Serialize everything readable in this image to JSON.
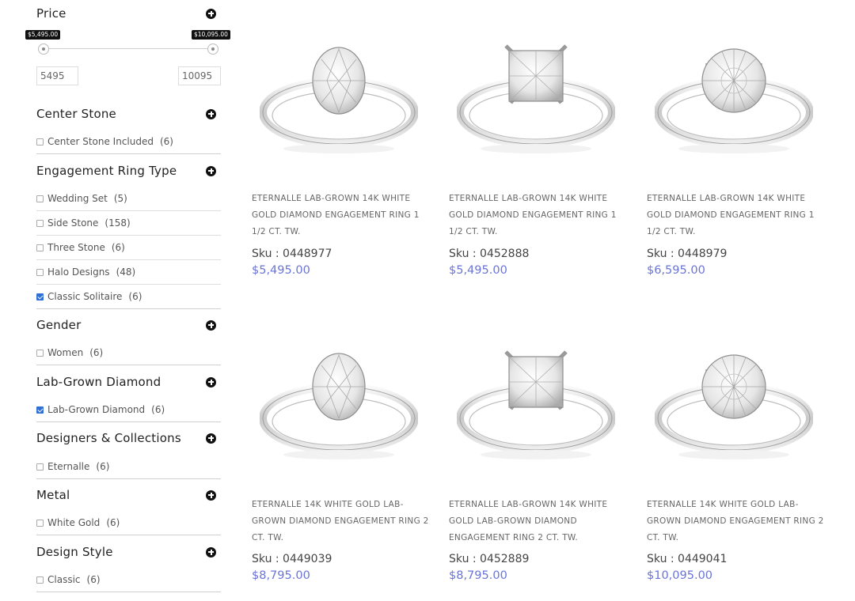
{
  "filters": {
    "price": {
      "title": "Price",
      "min_tip": "$5,495.00",
      "max_tip": "$10,095.00",
      "min_value": "5495",
      "max_value": "10095"
    },
    "center_stone": {
      "title": "Center Stone",
      "options": [
        {
          "label": "Center Stone Included",
          "count": "(6)",
          "checked": false
        }
      ]
    },
    "ring_type": {
      "title": "Engagement Ring Type",
      "options": [
        {
          "label": "Wedding Set",
          "count": "(5)",
          "checked": false
        },
        {
          "label": "Side Stone",
          "count": "(158)",
          "checked": false
        },
        {
          "label": "Three Stone",
          "count": "(6)",
          "checked": false
        },
        {
          "label": "Halo Designs",
          "count": "(48)",
          "checked": false
        },
        {
          "label": "Classic Solitaire",
          "count": "(6)",
          "checked": true
        }
      ]
    },
    "gender": {
      "title": "Gender",
      "options": [
        {
          "label": "Women",
          "count": "(6)",
          "checked": false
        }
      ]
    },
    "lab_grown": {
      "title": "Lab-Grown Diamond",
      "options": [
        {
          "label": "Lab-Grown Diamond",
          "count": "(6)",
          "checked": true
        }
      ]
    },
    "designers": {
      "title": "Designers & Collections",
      "options": [
        {
          "label": "Eternalle",
          "count": "(6)",
          "checked": false
        }
      ]
    },
    "metal": {
      "title": "Metal",
      "options": [
        {
          "label": "White Gold",
          "count": "(6)",
          "checked": false
        }
      ]
    },
    "design_style": {
      "title": "Design Style",
      "options": [
        {
          "label": "Classic",
          "count": "(6)",
          "checked": false
        }
      ]
    }
  },
  "products": [
    {
      "name": "ETERNALLE LAB-GROWN 14K WHITE GOLD DIAMOND ENGAGEMENT RING 1 1/2 CT. TW.",
      "sku": "Sku : 0448977",
      "price": "$5,495.00",
      "shape": "oval"
    },
    {
      "name": "ETERNALLE LAB-GROWN 14K WHITE GOLD DIAMOND ENGAGEMENT RING 1 1/2 CT. TW.",
      "sku": "Sku : 0452888",
      "price": "$5,495.00",
      "shape": "princess"
    },
    {
      "name": "ETERNALLE LAB-GROWN 14K WHITE GOLD DIAMOND ENGAGEMENT RING 1 1/2 CT. TW.",
      "sku": "Sku : 0448979",
      "price": "$6,595.00",
      "shape": "round"
    },
    {
      "name": "ETERNALLE 14K WHITE GOLD LAB-GROWN DIAMOND ENGAGEMENT RING 2 CT. TW.",
      "sku": "Sku : 0449039",
      "price": "$8,795.00",
      "shape": "oval"
    },
    {
      "name": "ETERNALLE LAB-GROWN 14K WHITE GOLD LAB-GROWN DIAMOND ENGAGEMENT RING 2 CT. TW.",
      "sku": "Sku : 0452889",
      "price": "$8,795.00",
      "shape": "princess"
    },
    {
      "name": "ETERNALLE 14K WHITE GOLD LAB-GROWN DIAMOND ENGAGEMENT RING 2 CT. TW.",
      "sku": "Sku : 0449041",
      "price": "$10,095.00",
      "shape": "round"
    }
  ]
}
